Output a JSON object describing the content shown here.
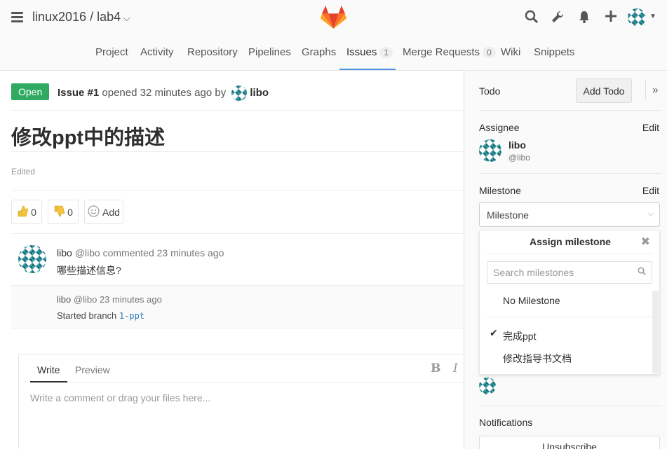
{
  "header": {
    "project_path": "linux2016 / lab4",
    "nav": [
      {
        "label": "Project"
      },
      {
        "label": "Activity"
      },
      {
        "label": "Repository"
      },
      {
        "label": "Pipelines"
      },
      {
        "label": "Graphs"
      },
      {
        "label": "Issues",
        "count": "1",
        "active": true
      },
      {
        "label": "Merge Requests",
        "count": "0"
      },
      {
        "label": "Wiki"
      },
      {
        "label": "Snippets"
      }
    ]
  },
  "issue": {
    "status": "Open",
    "ref": "Issue #1",
    "opened_text": "opened 32 minutes ago by",
    "author": "libo",
    "title": "修改ppt中的描述",
    "edited": "Edited",
    "thumbs_up": "0",
    "thumbs_down": "0",
    "add_award": "Add"
  },
  "notes": [
    {
      "author": "libo",
      "handle": "@libo",
      "meta": "commented 23 minutes ago",
      "body": "哪些描述信息?"
    }
  ],
  "system_note": {
    "author": "libo",
    "handle": "@libo",
    "time": "23 minutes ago",
    "text": "Started branch",
    "branch": "1-ppt"
  },
  "comment": {
    "tab_write": "Write",
    "tab_preview": "Preview",
    "bold": "B",
    "italic": "I",
    "placeholder": "Write a comment or drag your files here..."
  },
  "sidebar": {
    "todo_label": "Todo",
    "add_todo": "Add Todo",
    "assignee_label": "Assignee",
    "edit": "Edit",
    "assignee_name": "libo",
    "assignee_user": "@libo",
    "milestone_label": "Milestone",
    "milestone_select": "Milestone",
    "notifications_label": "Notifications",
    "unsubscribe": "Unsubscribe"
  },
  "milestone_dropdown": {
    "title": "Assign milestone",
    "search_placeholder": "Search milestones",
    "no_milestone": "No Milestone",
    "items": [
      {
        "label": "完成ppt",
        "checked": true
      },
      {
        "label": "修改指导书文档",
        "checked": false
      }
    ]
  },
  "colors": {
    "open_badge": "#2faa60",
    "active_tab_underline": "#4a90e2",
    "branch_link": "#2b7ab8",
    "avatar_primary": "#3aa0a8"
  }
}
